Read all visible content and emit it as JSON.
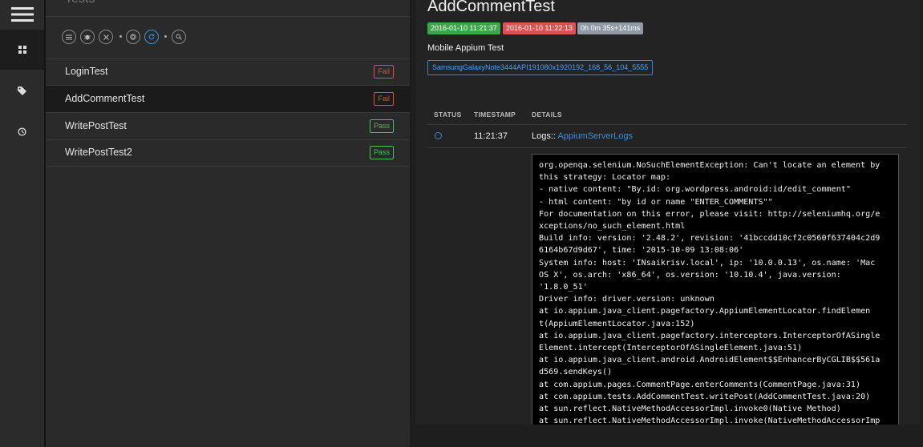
{
  "nav": {
    "items": [
      {
        "icon": "dashboard-icon",
        "active": true
      },
      {
        "icon": "tag-icon",
        "active": false
      },
      {
        "icon": "timer-icon",
        "active": false
      }
    ]
  },
  "tests_panel": {
    "title": "Tests",
    "toolbar": [
      "list-icon",
      "bug-icon",
      "close-icon",
      "fingerprint-icon",
      "refresh-icon",
      "search-icon"
    ],
    "rows": [
      {
        "name": "LoginTest",
        "status": "Fail"
      },
      {
        "name": "AddCommentTest",
        "status": "Fail"
      },
      {
        "name": "WritePostTest",
        "status": "Pass"
      },
      {
        "name": "WritePostTest2",
        "status": "Pass"
      }
    ]
  },
  "detail": {
    "title": "AddCommentTest",
    "start_time": "2016-01-10 11:21:37",
    "end_time": "2016-01-10 11:22:13",
    "duration": "0h 0m 35s+141ms",
    "description": "Mobile Appium Test",
    "device": "SamsungGalaxyNote3444API191080x1920192_168_56_104_5555",
    "headers": {
      "status": "STATUS",
      "timestamp": "TIMESTAMP",
      "details": "DETAILS"
    },
    "log": {
      "time": "11:21:37",
      "label": "Logs::",
      "link": "AppiumServerLogs",
      "stack": "org.openqa.selenium.NoSuchElementException: Can't locate an element by\nthis strategy: Locator map:\n- native content: \"By.id: org.wordpress.android:id/edit_comment\"\n- html content: \"by id or name \"ENTER_COMMENTS\"\"\nFor documentation on this error, please visit: http://seleniumhq.org/e\nxceptions/no_such_element.html\nBuild info: version: '2.48.2', revision: '41bccdd10cf2c0560f637404c2d9\n6164b67d9d67', time: '2015-10-09 13:08:06'\nSystem info: host: 'INsaikrisv.local', ip: '10.0.0.13', os.name: 'Mac\nOS X', os.arch: 'x86_64', os.version: '10.10.4', java.version:\n'1.8.0_51'\nDriver info: driver.version: unknown\nat io.appium.java_client.pagefactory.AppiumElementLocator.findElemen\nt(AppiumElementLocator.java:152)\nat io.appium.java_client.pagefactory.interceptors.InterceptorOfASingle\nElement.intercept(InterceptorOfASingleElement.java:51)\nat io.appium.java_client.android.AndroidElement$$EnhancerByCGLIB$$561a\nd569.sendKeys()\nat com.appium.pages.CommentPage.enterComments(CommentPage.java:31)\nat com.appium.tests.AddCommentTest.writePost(AddCommentTest.java:20)\nat sun.reflect.NativeMethodAccessorImpl.invoke0(Native Method)\nat sun.reflect.NativeMethodAccessorImpl.invoke(NativeMethodAccessorImp"
    }
  },
  "colors": {
    "pass": "#4cc05a",
    "fail": "#e0503b",
    "start_chip": "#3ea64a",
    "end_chip": "#d9534f",
    "duration_chip": "#8f9aa5",
    "accent": "#3b8fd4"
  }
}
